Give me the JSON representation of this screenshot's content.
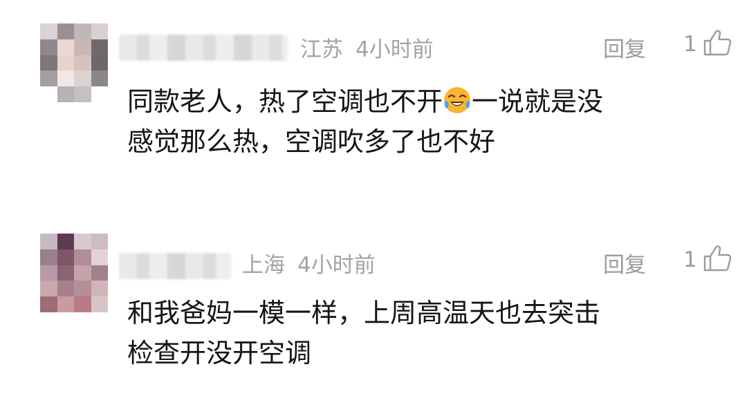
{
  "comments": [
    {
      "location": "江苏",
      "time": "4小时前",
      "reply_label": "回复",
      "likes": "1",
      "text_before_emoji": "同款老人，热了空调也不开",
      "emoji": "crying-laughing-emoji",
      "text_after_emoji": "一说就是没",
      "text_line2": "感觉那么热，空调吹多了也不好"
    },
    {
      "location": "上海",
      "time": "4小时前",
      "reply_label": "回复",
      "likes": "1",
      "text_line1": "和我爸妈一模一样，上周高温天也去突击",
      "text_line2": "检查开没开空调"
    }
  ]
}
